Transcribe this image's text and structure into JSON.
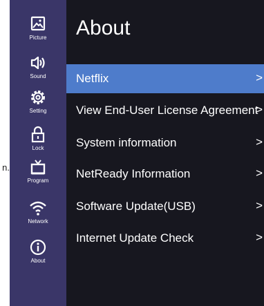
{
  "edge_text": "n.",
  "sidebar": {
    "items": [
      {
        "label": "Picture",
        "icon": "picture-icon"
      },
      {
        "label": "Sound",
        "icon": "sound-icon"
      },
      {
        "label": "Setting",
        "icon": "gear-icon"
      },
      {
        "label": "Lock",
        "icon": "lock-icon"
      },
      {
        "label": "Program",
        "icon": "tv-icon"
      },
      {
        "label": "Network",
        "icon": "wifi-icon"
      },
      {
        "label": "About",
        "icon": "info-icon"
      }
    ]
  },
  "page": {
    "title": "About",
    "selected_index": 0,
    "items": [
      {
        "label": "Netflix",
        "chevron": ">"
      },
      {
        "label": "View End-User License Agreement",
        "chevron": ">"
      },
      {
        "label": "System information",
        "chevron": ">"
      },
      {
        "label": "NetReady Information",
        "chevron": ">"
      },
      {
        "label": "Software Update(USB)",
        "chevron": ">"
      },
      {
        "label": "Internet Update Check",
        "chevron": ">"
      }
    ]
  },
  "colors": {
    "sidebar_bg": "#3a3668",
    "main_bg": "#17171f",
    "selected_bg": "#4e7ccb",
    "text": "#ffffff"
  }
}
